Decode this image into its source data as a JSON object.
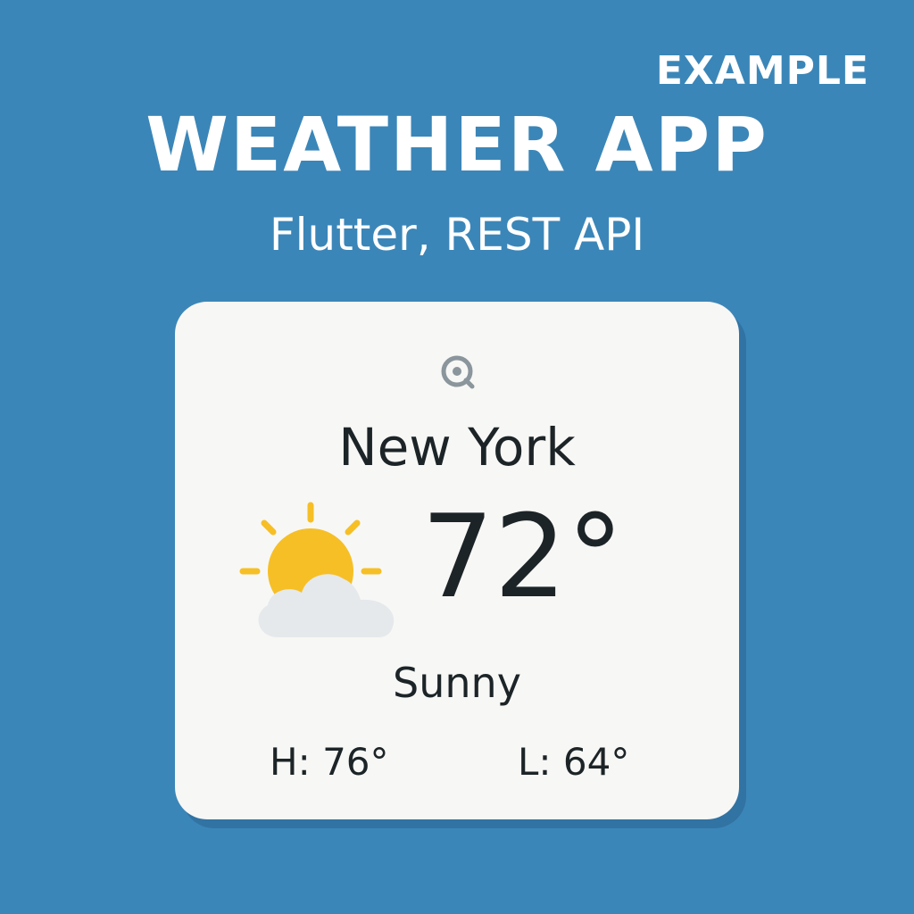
{
  "header": {
    "example_label": "EXAMPLE",
    "title": "WEATHER APP",
    "subtitle": "Flutter, REST API"
  },
  "card": {
    "location_icon": "location-target-icon",
    "city": "New York",
    "weather_icon": "partly-sunny-icon",
    "temperature": "72°",
    "condition": "Sunny",
    "high": "H: 76°",
    "low": "L: 64°"
  },
  "colors": {
    "background": "#3b86b8",
    "card": "#f7f7f5",
    "text": "#1c2427",
    "sun": "#f6bf26",
    "cloud": "#e5e9ec",
    "icon_gray": "#8a959c"
  }
}
